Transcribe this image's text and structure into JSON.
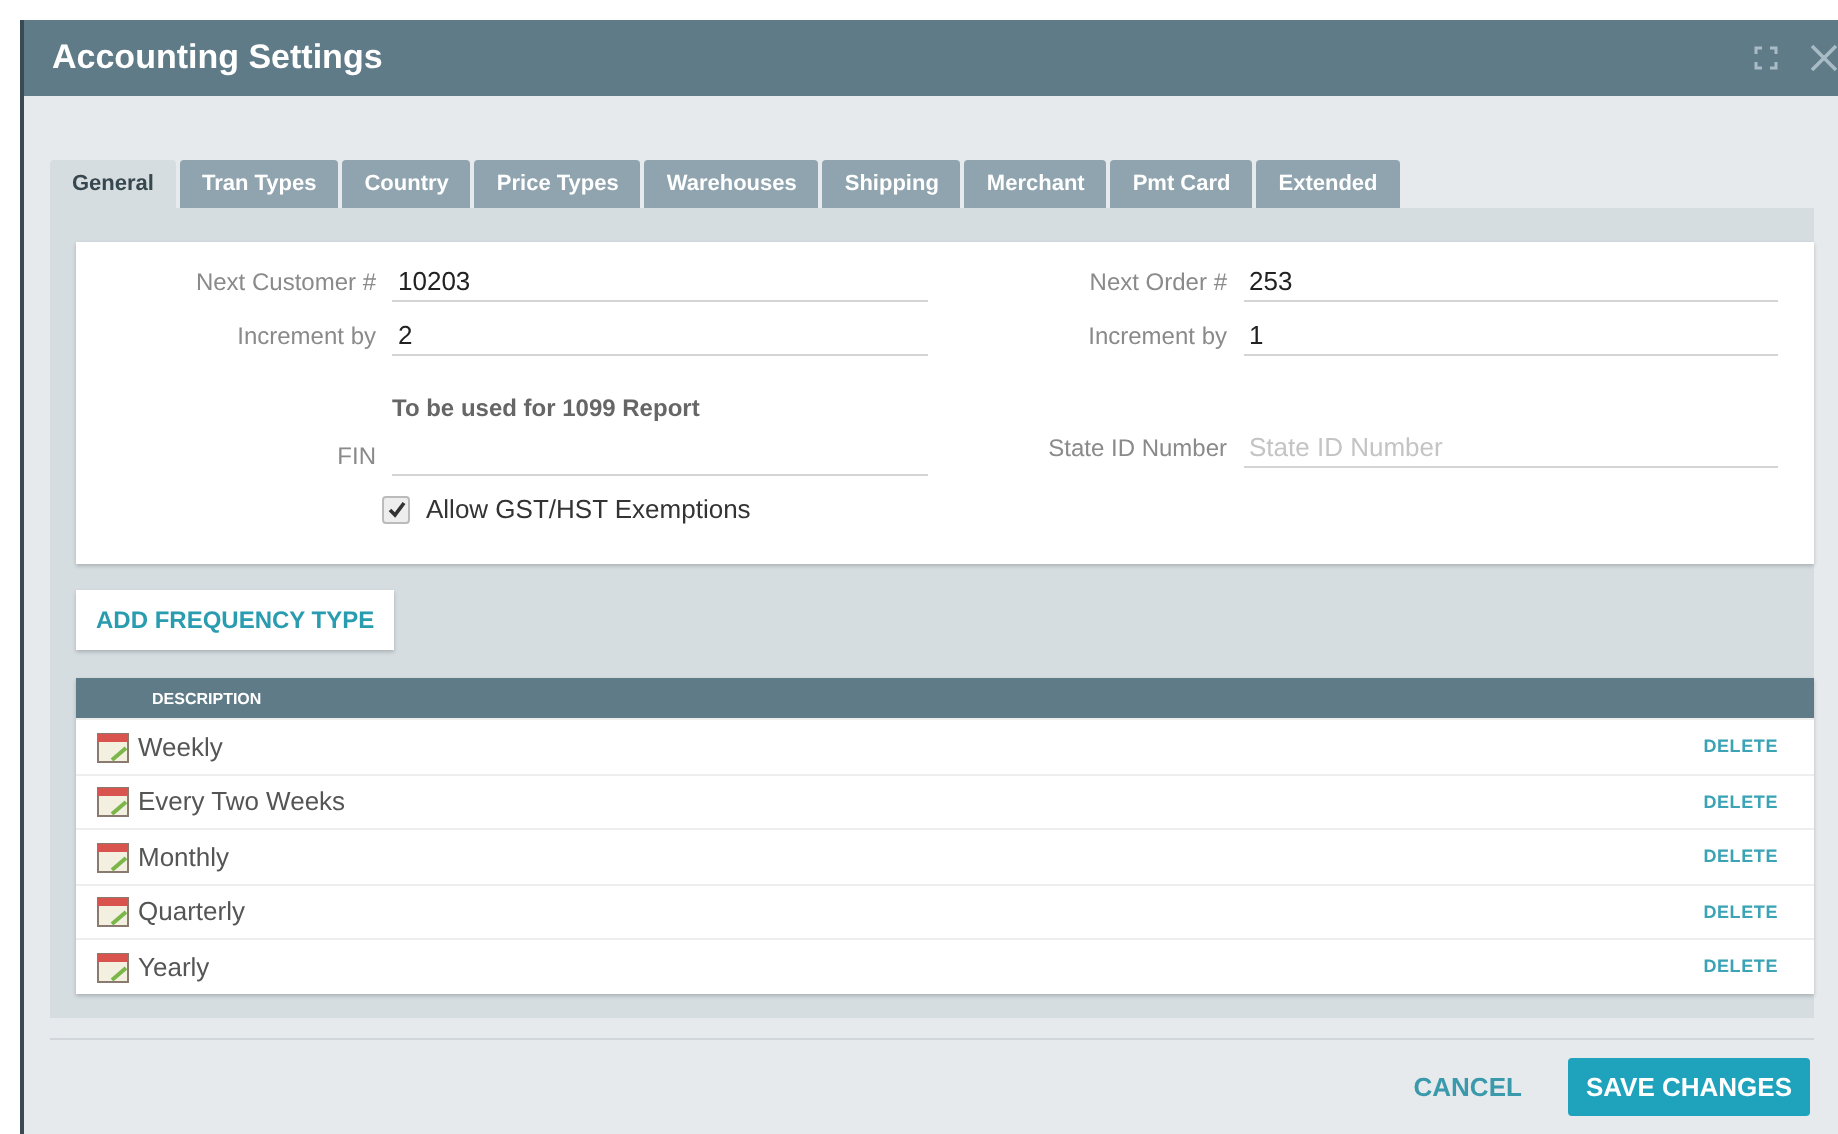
{
  "window": {
    "title": "Accounting Settings"
  },
  "tabs": [
    {
      "label": "General",
      "selected": true
    },
    {
      "label": "Tran Types",
      "selected": false
    },
    {
      "label": "Country",
      "selected": false
    },
    {
      "label": "Price Types",
      "selected": false
    },
    {
      "label": "Warehouses",
      "selected": false
    },
    {
      "label": "Shipping",
      "selected": false
    },
    {
      "label": "Merchant",
      "selected": false
    },
    {
      "label": "Pmt Card",
      "selected": false
    },
    {
      "label": "Extended",
      "selected": false
    }
  ],
  "form": {
    "left": [
      {
        "label": "Next Customer #",
        "value": "10203"
      },
      {
        "label": "Increment by",
        "value": "2"
      }
    ],
    "right": [
      {
        "label": "Next Order #",
        "value": "253"
      },
      {
        "label": "Increment by",
        "value": "1"
      }
    ],
    "fin_note": "To be used for 1099 Report",
    "fin": {
      "label": "FIN"
    },
    "state_id": {
      "label": "State ID Number",
      "placeholder": "State ID Number"
    },
    "exemptions": {
      "label": "Allow GST/HST Exemptions",
      "checked": true
    }
  },
  "add_button": "ADD FREQUENCY TYPE",
  "table": {
    "columns": [
      "DESCRIPTION"
    ],
    "rows": [
      {
        "description": "Weekly",
        "action": "DELETE"
      },
      {
        "description": "Every Two Weeks",
        "action": "DELETE"
      },
      {
        "description": "Monthly",
        "action": "DELETE"
      },
      {
        "description": "Quarterly",
        "action": "DELETE"
      },
      {
        "description": "Yearly",
        "action": "DELETE"
      }
    ]
  },
  "buttons": [
    {
      "label": "CANCEL",
      "kind": "text"
    },
    {
      "label": "SAVE CHANGES",
      "kind": "primary"
    }
  ]
}
